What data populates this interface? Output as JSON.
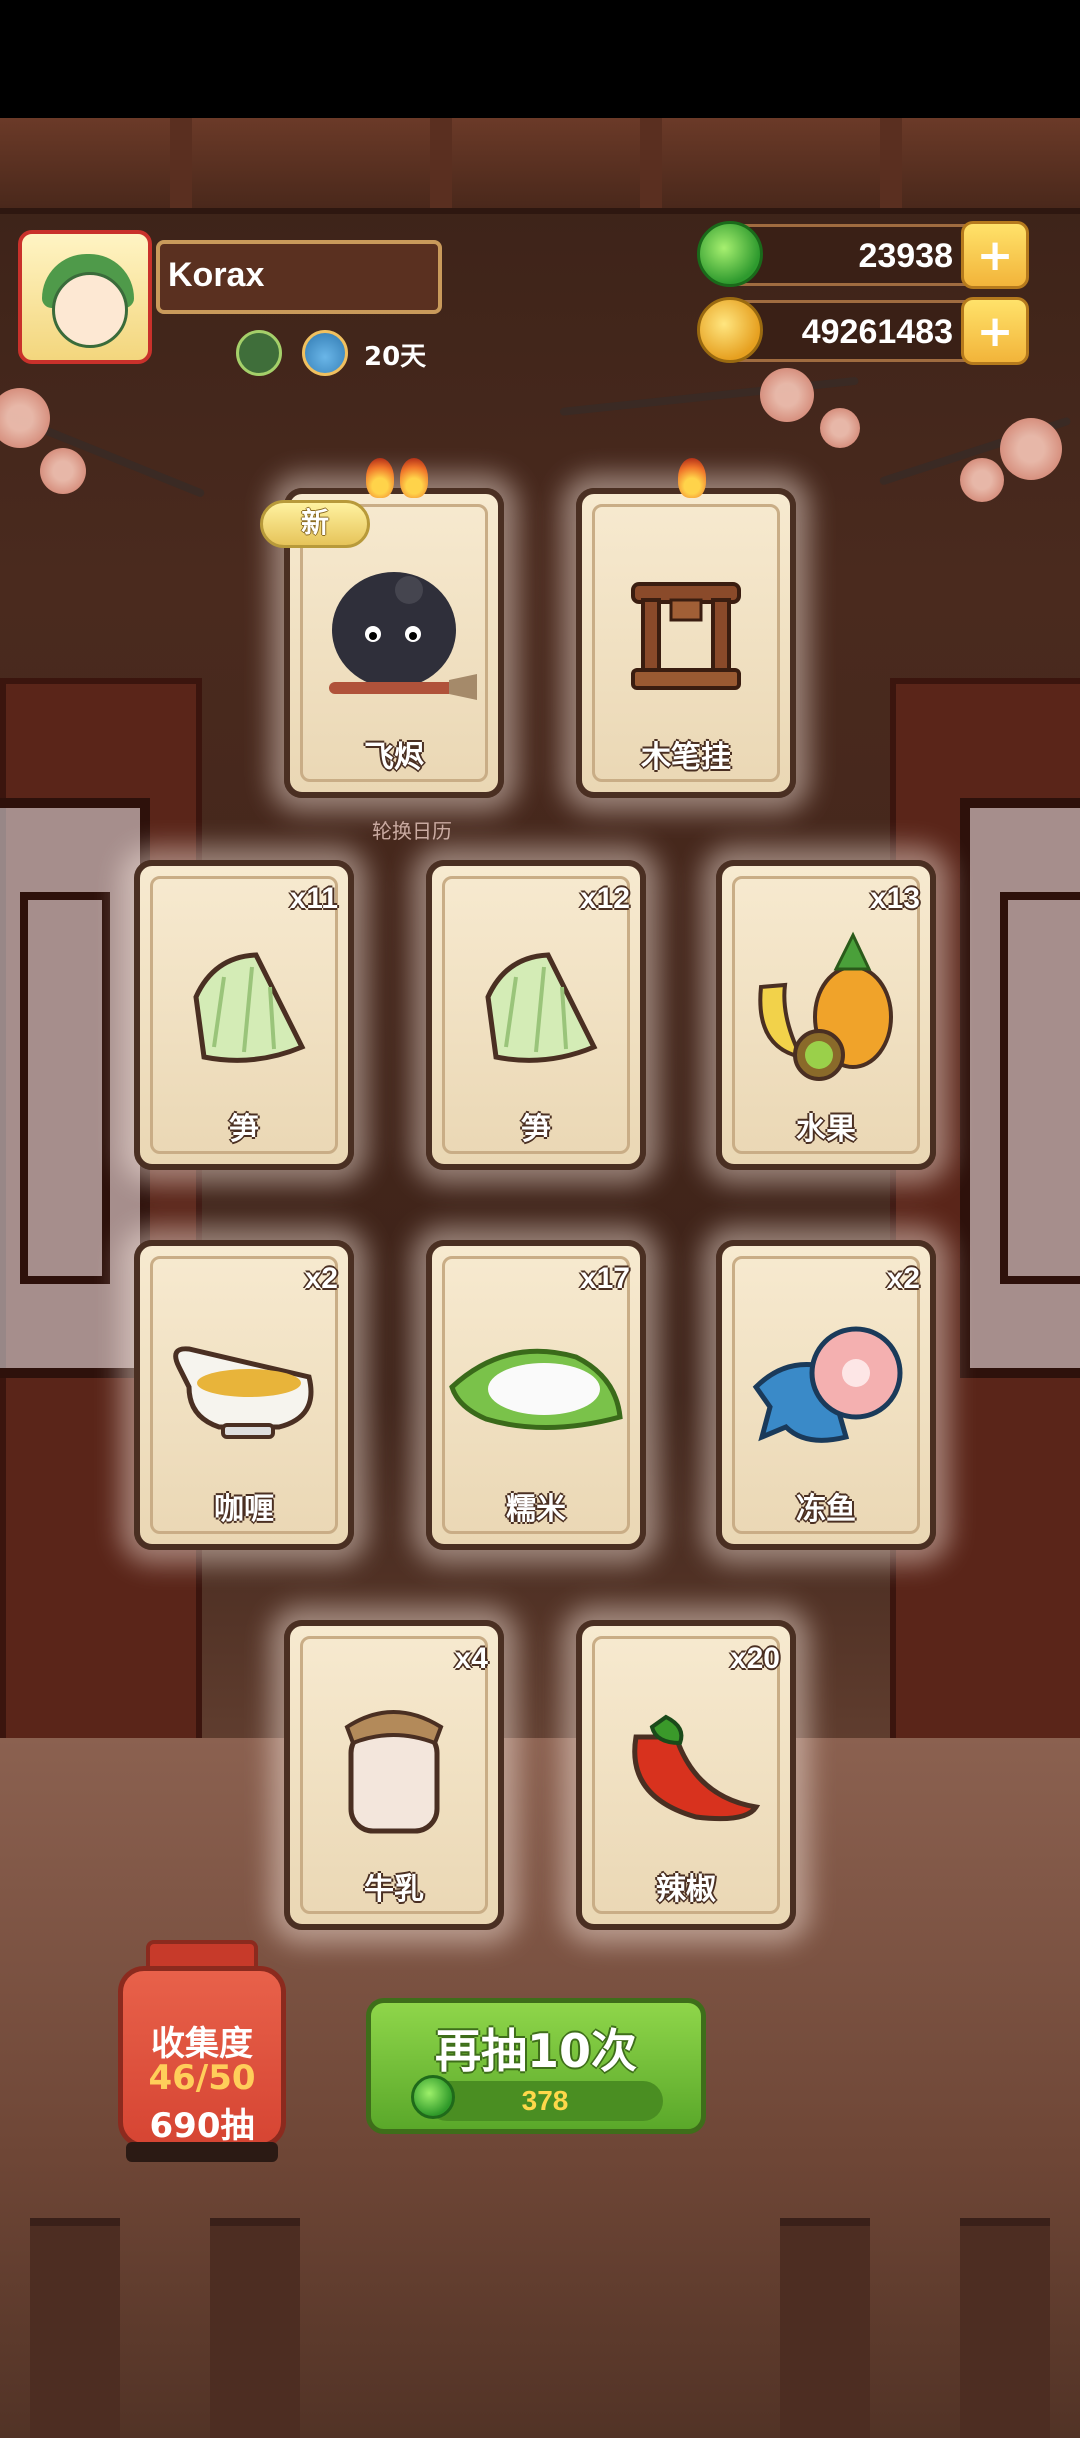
{
  "player": {
    "name": "Korax",
    "days": "20天"
  },
  "currency": {
    "jade": "23938",
    "gold": "49261483"
  },
  "top_cards": [
    {
      "name": "飞烬",
      "flames": 2,
      "is_new": true,
      "new_label": "新"
    },
    {
      "name": "木笔挂",
      "flames": 1,
      "is_new": false
    }
  ],
  "calendar_label": "轮换日历",
  "cards": [
    {
      "name": "笋",
      "count": "x11",
      "icon": "bamboo-shoot-icon"
    },
    {
      "name": "笋",
      "count": "x12",
      "icon": "bamboo-shoot-icon"
    },
    {
      "name": "水果",
      "count": "x13",
      "icon": "fruit-icon"
    },
    {
      "name": "咖喱",
      "count": "x2",
      "icon": "curry-icon"
    },
    {
      "name": "糯米",
      "count": "x17",
      "icon": "rice-icon"
    },
    {
      "name": "冻鱼",
      "count": "x2",
      "icon": "frozen-fish-icon"
    },
    {
      "name": "牛乳",
      "count": "x4",
      "icon": "milk-icon"
    },
    {
      "name": "辣椒",
      "count": "x20",
      "icon": "chili-icon"
    }
  ],
  "collection": {
    "title": "收集度",
    "progress": "46/50",
    "pulls": "690抽"
  },
  "redraw": {
    "label": "再抽10次",
    "cost": "378"
  },
  "colors": {
    "accent_green": "#5aa82a",
    "lantern_red": "#d64533",
    "gold": "#f2b43a"
  }
}
